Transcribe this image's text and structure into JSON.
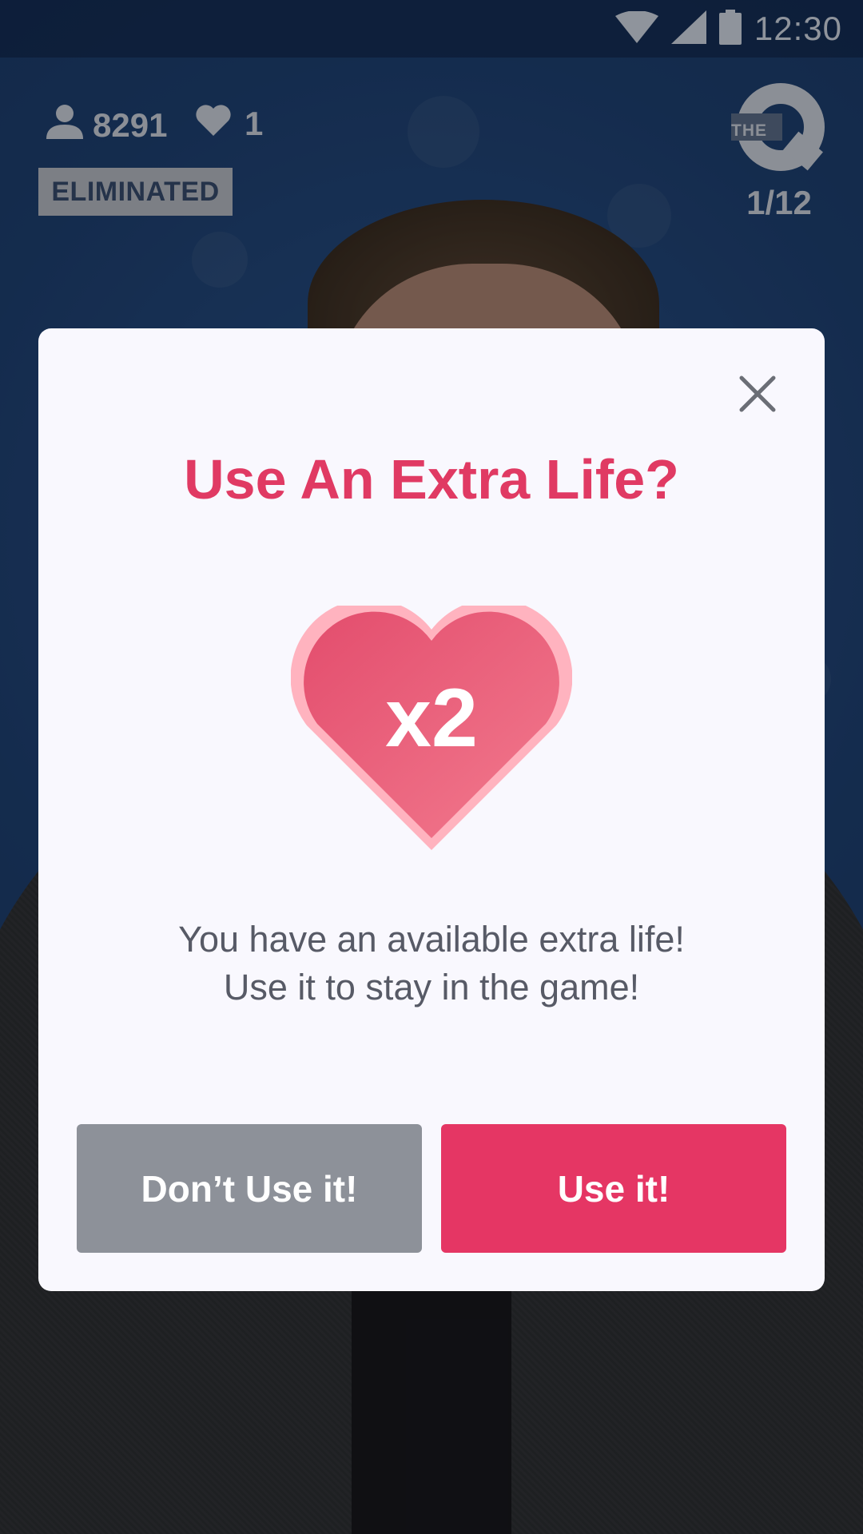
{
  "status_bar": {
    "time": "12:30",
    "icons": [
      "wifi-icon",
      "cell-signal-icon",
      "battery-icon"
    ]
  },
  "game_header": {
    "player_count": "8291",
    "lives": "1",
    "status_badge": "ELIMINATED",
    "logo_text": "THE",
    "question_progress": "1/12"
  },
  "modal": {
    "title": "Use An Extra Life?",
    "heart_count": "x2",
    "message_line1": "You have an available extra life!",
    "message_line2": "Use it to stay in the game!",
    "decline_label": "Don’t Use it!",
    "accept_label": "Use it!"
  },
  "colors": {
    "accent": "#e53664",
    "title": "#e03a63",
    "decline": "#8d9199",
    "modal_bg": "#f9f8fe"
  }
}
